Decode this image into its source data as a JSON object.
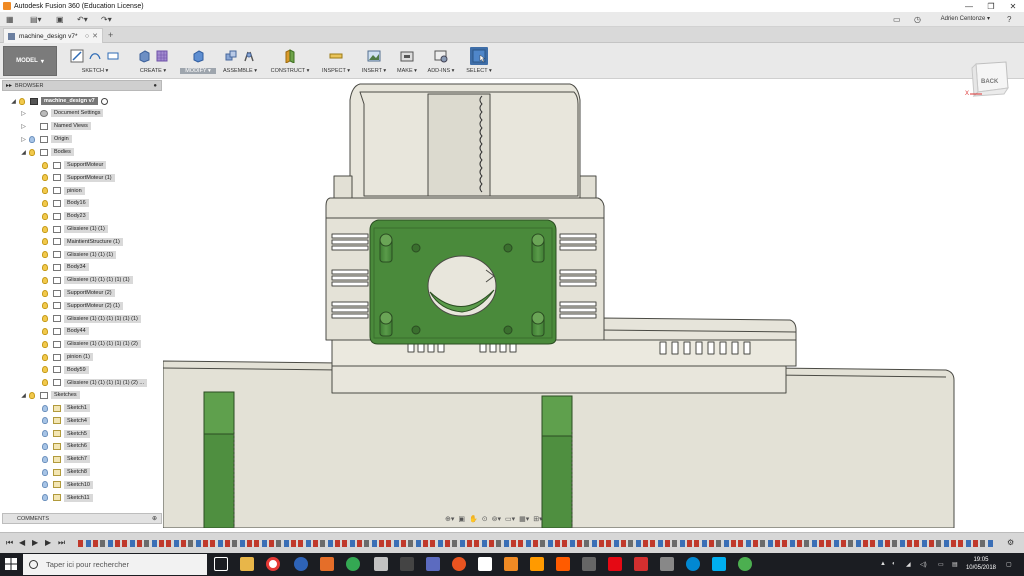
{
  "window": {
    "title": "Autodesk Fusion 360 (Education License)",
    "controls": [
      "—",
      "❐",
      "✕"
    ]
  },
  "qat": {
    "user_name": "Adrien Centonze ▾"
  },
  "tab": {
    "label": "machine_design v7*",
    "add": "+"
  },
  "ribbon": {
    "workspace": "MODEL",
    "groups": [
      {
        "label": "SKETCH ▾"
      },
      {
        "label": "CREATE ▾"
      },
      {
        "label": "MODIFY ▾"
      },
      {
        "label": "ASSEMBLE ▾"
      },
      {
        "label": "CONSTRUCT ▾"
      },
      {
        "label": "INSPECT ▾"
      },
      {
        "label": "INSERT ▾"
      },
      {
        "label": "MAKE ▾"
      },
      {
        "label": "ADD-INS ▾"
      },
      {
        "label": "SELECT ▾"
      }
    ]
  },
  "browser": {
    "header": "BROWSER",
    "root": "machine_design v7",
    "nodes": [
      {
        "label": "Document Settings"
      },
      {
        "label": "Named Views"
      },
      {
        "label": "Origin"
      },
      {
        "label": "Bodies"
      }
    ],
    "bodies": [
      "SupportMoteur",
      "SupportMoteur (1)",
      "pinion",
      "Body16",
      "Body23",
      "Glissiere (1) (1)",
      "MaintientStructure (1)",
      "Glissiere (1) (1) (1)",
      "Body34",
      "Glissiere (1) (1) (1) (1) (1)",
      "SupportMoteur (2)",
      "SupportMoteur (2) (1)",
      "Glissiere (1) (1) (1) (1) (1) (1)",
      "Body44",
      "Glissiere (1) (1) (1) (1) (1) (2)",
      "pinion (1)",
      "Body59",
      "Glissiere (1) (1) (1) (1) (1) (2) ..."
    ],
    "sketches_label": "Sketches",
    "sketches": [
      "Sketch1",
      "Sketch4",
      "Sketch5",
      "Sketch6",
      "Sketch7",
      "Sketch8",
      "Sketch10",
      "Sketch11"
    ]
  },
  "comments": {
    "label": "COMMENTS"
  },
  "viewcube": {
    "face": "BACK",
    "axis_x": "X"
  },
  "taskbar": {
    "search_placeholder": "Taper ici pour rechercher",
    "time": "19:05",
    "date": "10/05/2018"
  },
  "colors": {
    "green": "#4a8a3b",
    "body_fill": "#e6e4da",
    "outline": "#4a4a44",
    "taskbar": "#1b1d22"
  }
}
